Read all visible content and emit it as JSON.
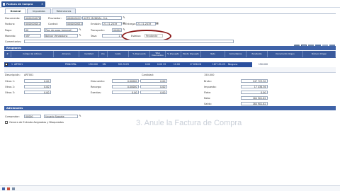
{
  "title_bar": {
    "title": "Factura de Compra",
    "close": "×"
  },
  "tabs": [
    {
      "label": "General"
    },
    {
      "label": "Impuestos"
    },
    {
      "label": "Retenciones"
    }
  ],
  "header": {
    "documento": {
      "label": "Documento:",
      "value": "00000000786"
    },
    "proveedor": {
      "label": "Proveedor:",
      "value": "00000001234",
      "name": "AUTO MUNDIAL, S.A."
    },
    "factura": {
      "label": "Factura:",
      "value": "00000000123"
    },
    "control": {
      "label": "Control:",
      "value": "00000000123"
    },
    "emision": {
      "label": "Emisión:",
      "value": "21-11-2019"
    },
    "entrega": {
      "label": "Entrega:",
      "value": "21-11-2019"
    },
    "pago": {
      "label": "Pago:",
      "value": "00",
      "name": "Plan de pago (general)"
    },
    "transporte": {
      "label": "Transporte:",
      "value": "00000"
    },
    "moneda": {
      "label": "Moneda:",
      "value": "VEF",
      "name": "Bolívar Venezolano"
    },
    "tasa": {
      "label": "Tasa:",
      "value": "1"
    },
    "estatus": {
      "label": "Estatus:",
      "value": "Pendiente"
    },
    "comentarios": {
      "label": "Comentarios:",
      "value": ""
    }
  },
  "renglones": {
    "title": "Renglones",
    "columns": [
      "#",
      "Código del Artículo",
      "Almacén",
      "Cantidad",
      "Uni.",
      "Costo",
      "% Descuento",
      "Total Descuentos",
      "% Impuesto",
      "Monto Impuesto",
      "Neto",
      "Comentarios",
      "Pendiente",
      "Documento Origen",
      "Número Origen"
    ],
    "rows": [
      {
        "num": "1",
        "code": "ART001",
        "almacen": "PRINCIPAL",
        "cantidad": "150.000",
        "uni": "UN",
        "costo": "991.5125",
        "pct_desc": "0.00",
        "total_desc": "0.00 13",
        "pct_imp": "12.00",
        "monto_imp": "17 838.26",
        "neto": "167 151.25",
        "comentarios": "Ninguno",
        "pendiente": "150.000",
        "doc_origen": "",
        "num_origen": ""
      }
    ]
  },
  "totals": {
    "descripcion": {
      "label": "Descripción:",
      "value": "ART001"
    },
    "cantidad": {
      "label": "Cantidad:",
      "value": "150.000"
    },
    "otros1": {
      "label": "Otros 1:",
      "value": "0.00"
    },
    "otros2": {
      "label": "Otros 2:",
      "value": "0.00"
    },
    "otros3": {
      "label": "Otros 3:",
      "value": "0.00"
    },
    "descuento": {
      "label": "Descuento:",
      "value": "0.00000",
      "amount": "0.00"
    },
    "recargo": {
      "label": "Recargo:",
      "value": "0.00000",
      "amount": "0.00"
    },
    "exentos": {
      "label": "Exentos:",
      "value": "0.00",
      "amount": "0.00"
    },
    "bruto": {
      "label": "Bruto:",
      "value": "147 723.30"
    },
    "impuesto": {
      "label": "Impuesto:",
      "value": "17 438.36"
    },
    "flete": {
      "label": "Flete:",
      "value": "0.00"
    },
    "neto": {
      "label": "Neto:",
      "value": "164 901.62"
    },
    "saldo": {
      "label": "Saldo:",
      "value": "164 901.62"
    }
  },
  "adicionales": {
    "title": "Adicionales",
    "comprador": {
      "label": "Comprador:",
      "value": "00000",
      "name": "Usuario Soporte"
    },
    "check_label": "Genera de Entrada Asignadas y Bloqueadas"
  },
  "overlay_caption": "3. Anule la Factura de Compra",
  "colors": {
    "accent": "#3f63a8",
    "title_bar": "#2e5496",
    "annotation": "#8b1a1a"
  }
}
